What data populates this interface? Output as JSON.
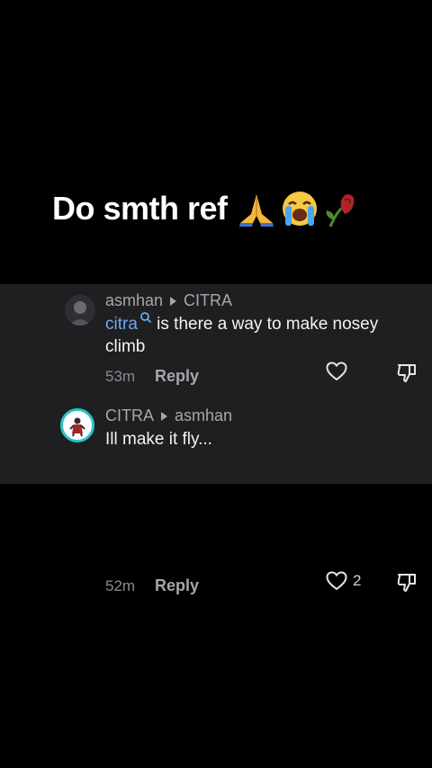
{
  "video": {
    "caption": "Do smth ref",
    "caption_emojis": [
      "folded-hands-icon",
      "loudly-crying-face-icon",
      "wilted-rose-icon"
    ]
  },
  "comments": [
    {
      "author": "asmhan",
      "reply_to": "CITRA",
      "mention": "citra",
      "text": " is there a way to make nosey climb",
      "time": "53m",
      "reply_label": "Reply",
      "likes": ""
    },
    {
      "author": "CITRA",
      "reply_to": "asmhan",
      "mention": "",
      "text": "Ill make it fly...",
      "time": "52m",
      "reply_label": "Reply",
      "likes": "2"
    }
  ],
  "colors": {
    "background": "#000000",
    "panel": "#1f1f21",
    "mention": "#6ea8f0",
    "avatar_ring": "#2cc3c9"
  }
}
